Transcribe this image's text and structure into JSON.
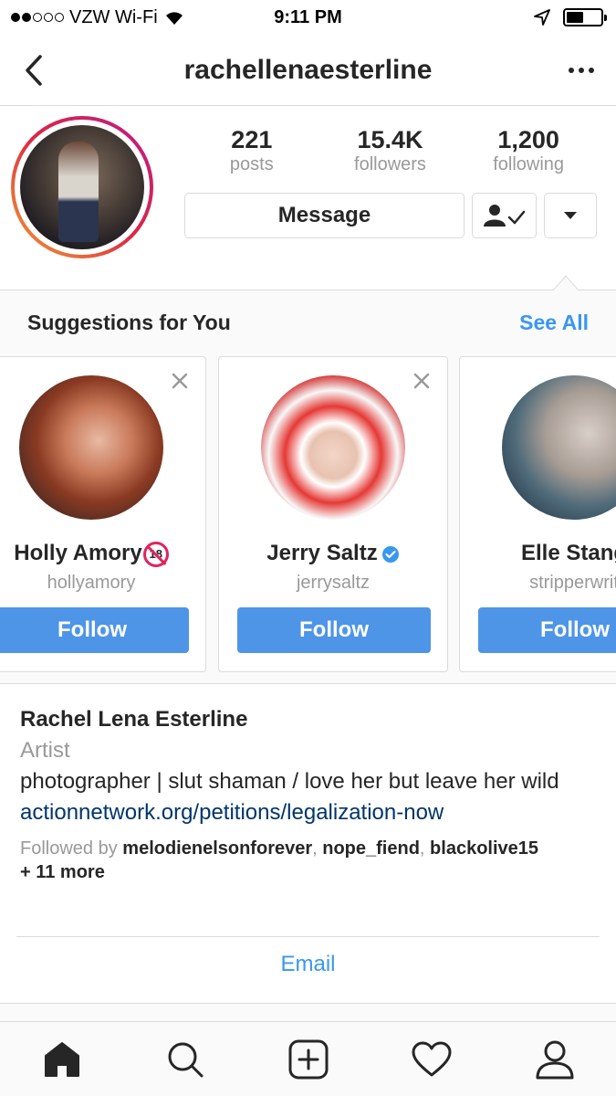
{
  "status_bar": {
    "carrier": "VZW Wi-Fi",
    "time": "9:11 PM",
    "battery_level": 0.5
  },
  "nav": {
    "title": "rachellenaesterline"
  },
  "profile": {
    "stats": [
      {
        "value": "221",
        "label": "posts"
      },
      {
        "value": "15.4K",
        "label": "followers"
      },
      {
        "value": "1,200",
        "label": "following"
      }
    ],
    "message_label": "Message"
  },
  "suggestions": {
    "title": "Suggestions for You",
    "see_all": "See All",
    "cards": [
      {
        "name": "Holly Amory",
        "handle": "hollyamory",
        "follow_label": "Follow",
        "badge": "18"
      },
      {
        "name": "Jerry Saltz",
        "handle": "jerrysaltz",
        "follow_label": "Follow"
      },
      {
        "name": "Elle Stang",
        "handle": "stripperwrit",
        "follow_label": "Follow"
      }
    ]
  },
  "bio": {
    "name": "Rachel Lena Esterline",
    "category": "Artist",
    "text": "photographer | slut shaman / love her but leave her wild",
    "link": "actionnetwork.org/petitions/legalization-now",
    "followed_by_prefix": "Followed by ",
    "followed_by_names": [
      "melodienelsonforever",
      "nope_fiend",
      "blackolive15"
    ],
    "followed_by_more": "+ 11 more"
  },
  "email_label": "Email",
  "colors": {
    "accent": "#3897f0",
    "follow_button": "#4e95e8",
    "link": "#003569",
    "muted": "#999999"
  },
  "tabs": [
    "home-icon",
    "search-icon",
    "add-post-icon",
    "heart-icon",
    "profile-icon"
  ]
}
